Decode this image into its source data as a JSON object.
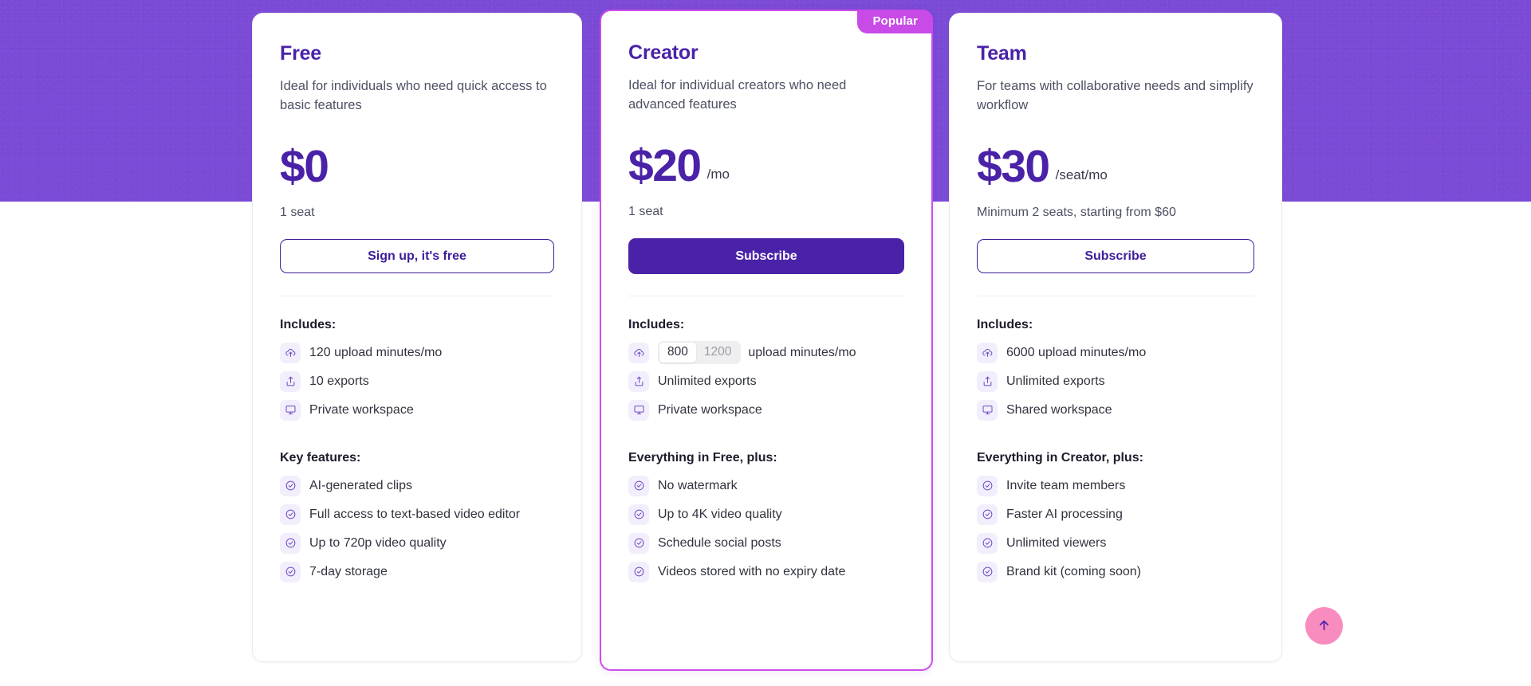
{
  "theme": {
    "banner_color": "#7B4AD6",
    "brand_purple": "#4A22A8",
    "featured_border": "#CC4FE8",
    "badge_color": "#C84BE8",
    "scroll_top_color": "#F98CBE",
    "icon_tile_bg": "#F3EEFC"
  },
  "scroll_top": {
    "icon": "arrow-up-icon",
    "label": "Back to top"
  },
  "plans": [
    {
      "id": "free",
      "name": "Free",
      "description": "Ideal for individuals who need quick access to basic features",
      "price": "$0",
      "price_unit": "",
      "seat_note": "1 seat",
      "cta_label": "Sign up, it's free",
      "cta_style": "outline",
      "featured": false,
      "badge": "",
      "sections": [
        {
          "title": "Includes:",
          "items": [
            {
              "icon": "cloud-upload-icon",
              "text": "120 upload minutes/mo"
            },
            {
              "icon": "export-share-icon",
              "text": "10 exports"
            },
            {
              "icon": "monitor-workspace-icon",
              "text": "Private workspace"
            }
          ]
        },
        {
          "title": "Key features:",
          "items": [
            {
              "icon": "check-circle-icon",
              "text": "AI-generated clips"
            },
            {
              "icon": "check-circle-icon",
              "text": "Full access to text-based video editor"
            },
            {
              "icon": "check-circle-icon",
              "text": "Up to 720p video quality"
            },
            {
              "icon": "check-circle-icon",
              "text": "7-day storage"
            }
          ]
        }
      ]
    },
    {
      "id": "creator",
      "name": "Creator",
      "description": "Ideal for individual creators who need advanced features",
      "price": "$20",
      "price_unit": "/mo",
      "seat_note": "1 seat",
      "cta_label": "Subscribe",
      "cta_style": "filled",
      "featured": true,
      "badge": "Popular",
      "sections": [
        {
          "title": "Includes:",
          "items": [
            {
              "icon": "cloud-upload-icon",
              "text": "upload minutes/mo",
              "toggle": {
                "options": [
                  "800",
                  "1200"
                ],
                "selected": "800"
              }
            },
            {
              "icon": "export-share-icon",
              "text": "Unlimited exports"
            },
            {
              "icon": "monitor-workspace-icon",
              "text": "Private workspace"
            }
          ]
        },
        {
          "title": "Everything in Free, plus:",
          "items": [
            {
              "icon": "check-circle-icon",
              "text": "No watermark"
            },
            {
              "icon": "check-circle-icon",
              "text": "Up to 4K video quality"
            },
            {
              "icon": "check-circle-icon",
              "text": "Schedule social posts"
            },
            {
              "icon": "check-circle-icon",
              "text": "Videos stored with no expiry date"
            }
          ]
        }
      ]
    },
    {
      "id": "team",
      "name": "Team",
      "description": "For teams with collaborative needs and simplify workflow",
      "price": "$30",
      "price_unit": "/seat/mo",
      "seat_note": "Minimum 2 seats, starting from $60",
      "cta_label": "Subscribe",
      "cta_style": "outline",
      "featured": false,
      "badge": "",
      "sections": [
        {
          "title": "Includes:",
          "items": [
            {
              "icon": "cloud-upload-icon",
              "text": "6000 upload minutes/mo"
            },
            {
              "icon": "export-share-icon",
              "text": "Unlimited exports"
            },
            {
              "icon": "monitor-workspace-icon",
              "text": "Shared workspace"
            }
          ]
        },
        {
          "title": "Everything in Creator, plus:",
          "items": [
            {
              "icon": "check-circle-icon",
              "text": "Invite team members"
            },
            {
              "icon": "check-circle-icon",
              "text": "Faster AI processing"
            },
            {
              "icon": "check-circle-icon",
              "text": "Unlimited viewers"
            },
            {
              "icon": "check-circle-icon",
              "text": "Brand kit (coming soon)"
            }
          ]
        }
      ]
    }
  ]
}
